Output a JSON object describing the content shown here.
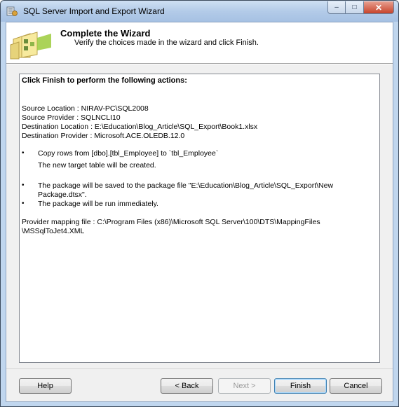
{
  "window": {
    "title": "SQL Server Import and Export Wizard",
    "caption_buttons": {
      "minimize": "‒",
      "maximize": "□",
      "close": "✕"
    }
  },
  "header": {
    "title": "Complete the Wizard",
    "subtitle": "Verify the choices made in the wizard and click Finish."
  },
  "summary": {
    "heading": "Click Finish to perform the following actions:",
    "source_location": "Source Location : NIRAV-PC\\SQL2008",
    "source_provider": "Source Provider : SQLNCLI10",
    "destination_location": "Destination Location : E:\\Education\\Blog_Article\\SQL_Export\\Book1.xlsx",
    "destination_provider": "Destination Provider : Microsoft.ACE.OLEDB.12.0",
    "bullet_glyph": "•",
    "action1_line1": "Copy rows from [dbo].[tbl_Employee] to `tbl_Employee`",
    "action1_line2": "The new target table will be created.",
    "action2_line1": "The package will be saved to the package file \"E:\\Education\\Blog_Article\\SQL_Export\\New",
    "action2_line2": "Package.dtsx\".",
    "action3": "The package will be run immediately.",
    "mapping_line1": "Provider mapping file : C:\\Program Files (x86)\\Microsoft SQL Server\\100\\DTS\\MappingFiles",
    "mapping_line2": "\\MSSqlToJet4.XML"
  },
  "buttons": {
    "help": "Help",
    "back": "< Back",
    "next": "Next >",
    "finish": "Finish",
    "cancel": "Cancel"
  },
  "icons": {
    "app": "sql-wizard-icon",
    "header": "wizard-folder-icon"
  }
}
